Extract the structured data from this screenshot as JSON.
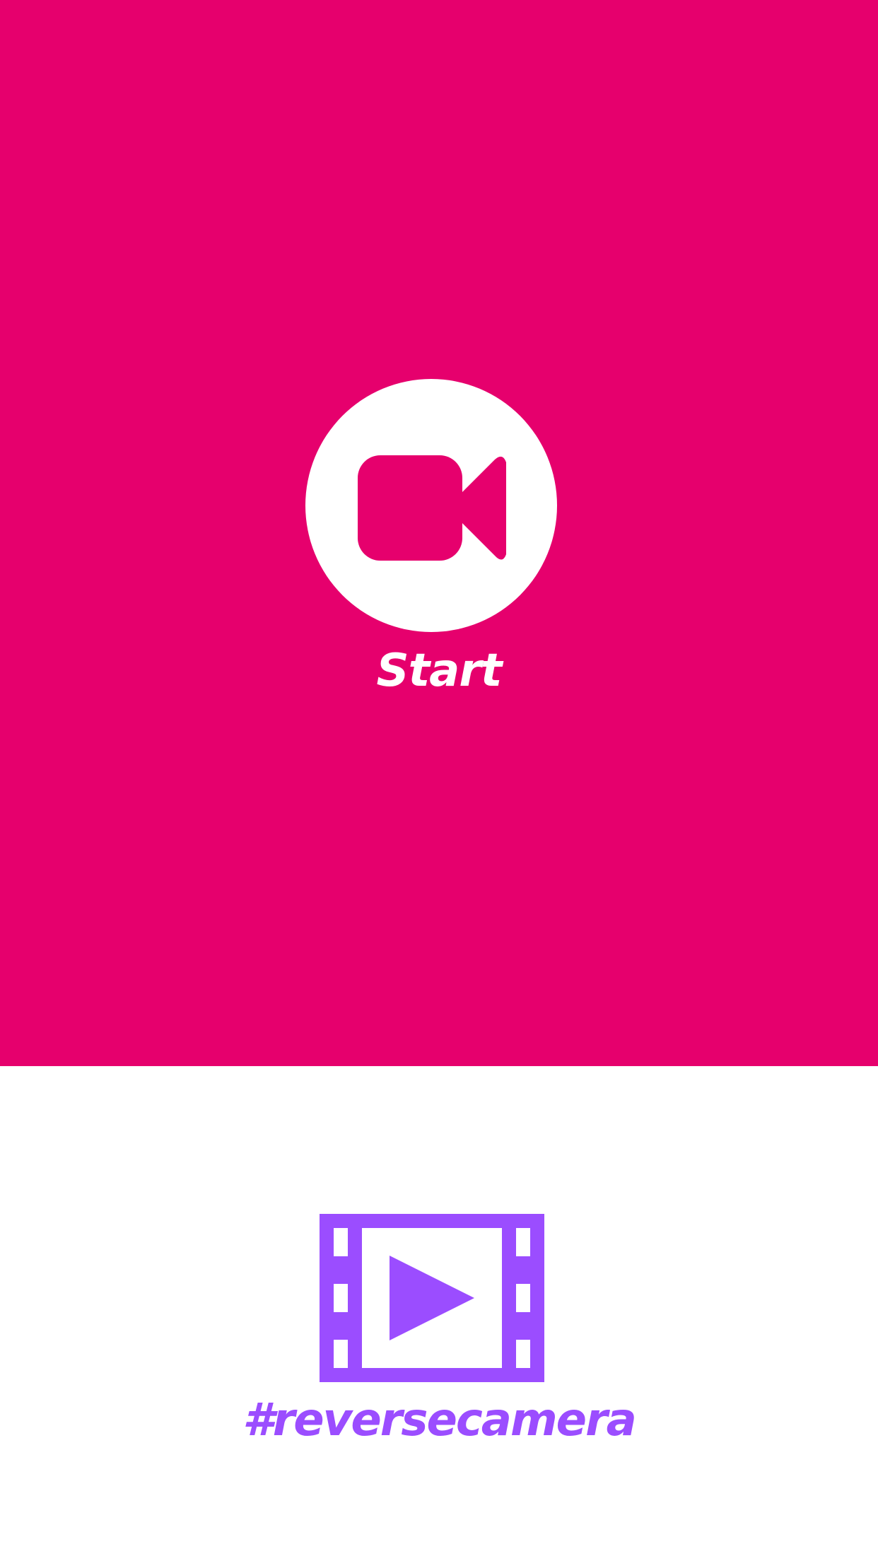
{
  "colors": {
    "top_background": "#e6006d",
    "bottom_background": "#ffffff",
    "accent_purple": "#9b4dff",
    "white": "#ffffff"
  },
  "record": {
    "icon": "video-camera-icon",
    "label": "Start"
  },
  "gallery": {
    "icon": "film-play-icon",
    "label": "#reversecamera"
  }
}
